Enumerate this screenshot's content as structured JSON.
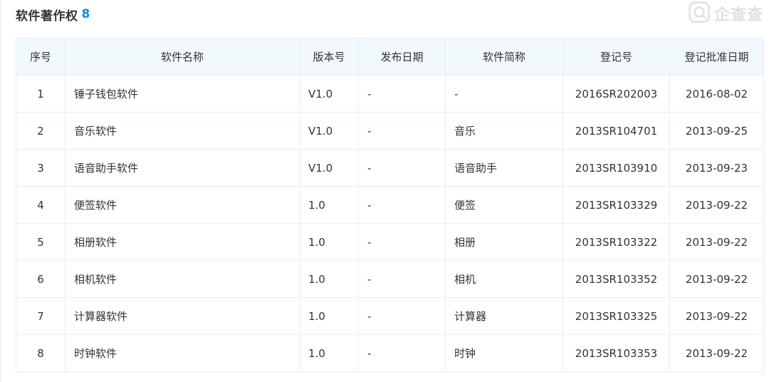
{
  "section": {
    "title": "软件著作权",
    "count": "8"
  },
  "watermark": {
    "text": "企查查",
    "icon": "qichacha-logo-icon"
  },
  "table": {
    "headers": [
      "序号",
      "软件名称",
      "版本号",
      "发布日期",
      "软件简称",
      "登记号",
      "登记批准日期"
    ],
    "rows": [
      [
        "1",
        "锤子钱包软件",
        "V1.0",
        "-",
        "-",
        "2016SR202003",
        "2016-08-02"
      ],
      [
        "2",
        "音乐软件",
        "V1.0",
        "-",
        "音乐",
        "2013SR104701",
        "2013-09-25"
      ],
      [
        "3",
        "语音助手软件",
        "V1.0",
        "-",
        "语音助手",
        "2013SR103910",
        "2013-09-23"
      ],
      [
        "4",
        "便签软件",
        "1.0",
        "-",
        "便签",
        "2013SR103329",
        "2013-09-22"
      ],
      [
        "5",
        "相册软件",
        "1.0",
        "-",
        "相册",
        "2013SR103322",
        "2013-09-22"
      ],
      [
        "6",
        "相机软件",
        "1.0",
        "-",
        "相机",
        "2013SR103352",
        "2013-09-22"
      ],
      [
        "7",
        "计算器软件",
        "1.0",
        "-",
        "计算器",
        "2013SR103325",
        "2013-09-22"
      ],
      [
        "8",
        "时钟软件",
        "1.0",
        "-",
        "时钟",
        "2013SR103353",
        "2013-09-22"
      ]
    ]
  },
  "colors": {
    "accent": "#128bed",
    "header_bg": "#f2f9fc",
    "border": "#e4eef6"
  }
}
